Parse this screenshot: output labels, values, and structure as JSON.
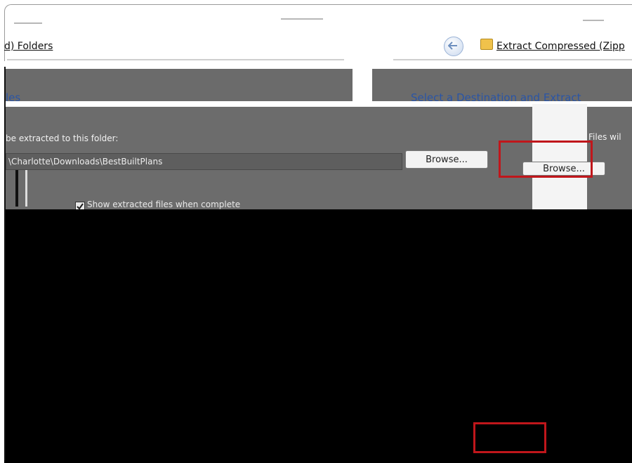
{
  "window": {
    "left_title": "d) Folders",
    "right_title": "Extract Compressed (Zipp"
  },
  "headings": {
    "left": "les",
    "right": "Select a Destination and Extract"
  },
  "extract_label": {
    "left": "be extracted to this folder:",
    "right": "Files wil"
  },
  "destination": {
    "path_value": "\\Charlotte\\Downloads\\BestBuiltPlans"
  },
  "buttons": {
    "browse": "Browse...",
    "browse_duplicate": "Browse..."
  },
  "options": {
    "show_files_label": "Show extracted files when complete"
  },
  "colors": {
    "highlight": "#c0161b",
    "heading_link": "#2a55a6"
  },
  "icons": {
    "back": "back-arrow-icon",
    "folder": "zip-folder-icon",
    "check": "checkbox-checked-icon"
  }
}
